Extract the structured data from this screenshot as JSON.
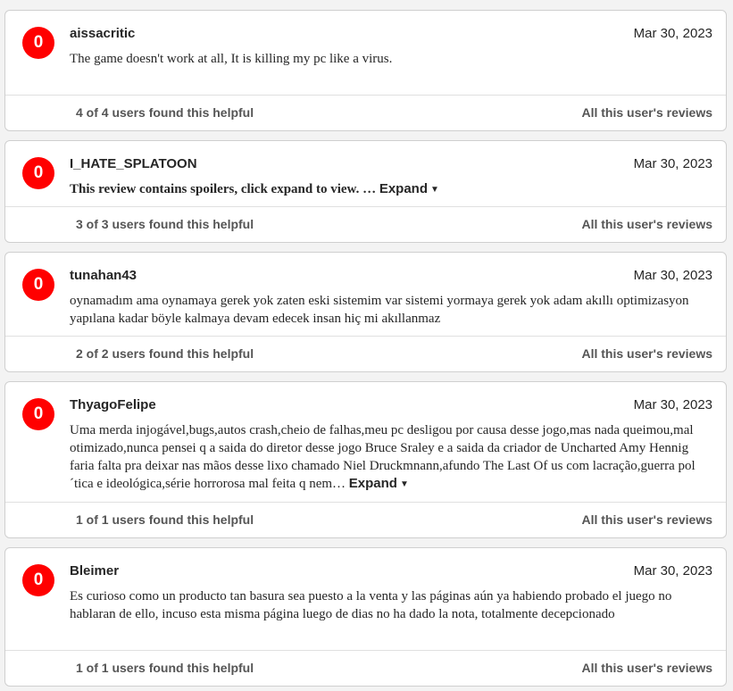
{
  "colors": {
    "score_negative": "#ff0000",
    "card_bg": "#ffffff",
    "page_bg": "#f3f3f3"
  },
  "reviews": [
    {
      "score": "0",
      "user": "aissacritic",
      "date": "Mar 30, 2023",
      "text": "The game doesn't work at all, It is killing my pc like a virus.",
      "helpful": "4 of 4 users found this helpful",
      "all_reviews": "All this user's reviews"
    },
    {
      "score": "0",
      "user": "I_HATE_SPLATOON",
      "date": "Mar 30, 2023",
      "text": "This review contains spoilers, click expand to view. …",
      "expand": "Expand",
      "helpful": "3 of 3 users found this helpful",
      "all_reviews": "All this user's reviews"
    },
    {
      "score": "0",
      "user": "tunahan43",
      "date": "Mar 30, 2023",
      "text": "oynamadım ama oynamaya gerek yok zaten eski sistemim var sistemi yormaya gerek yok adam akıllı optimizasyon yapılana kadar böyle kalmaya devam edecek insan hiç mi akıllanmaz",
      "helpful": "2 of 2 users found this helpful",
      "all_reviews": "All this user's reviews"
    },
    {
      "score": "0",
      "user": "ThyagoFelipe",
      "date": "Mar 30, 2023",
      "text": "Uma merda injogável,bugs,autos crash,cheio de falhas,meu pc desligou por causa desse jogo,mas nada queimou,mal otimizado,nunca pensei q a saida do diretor desse jogo Bruce Sraley e a saida da criador de Uncharted Amy Hennig faria falta pra deixar nas mãos desse lixo chamado Niel Druckmnann,afundo The Last Of us com lacração,guerra pol´tica e ideológica,série horrorosa mal feita q nem…",
      "expand": "Expand",
      "helpful": "1 of 1 users found this helpful",
      "all_reviews": "All this user's reviews"
    },
    {
      "score": "0",
      "user": "Bleimer",
      "date": "Mar 30, 2023",
      "text": "Es curioso como un producto tan basura sea puesto a la venta y las páginas aún ya habiendo probado el juego no hablaran de ello, incuso esta misma página luego de dias no ha dado la nota, totalmente decepcionado",
      "helpful": "1 of 1 users found this helpful",
      "all_reviews": "All this user's reviews"
    }
  ]
}
